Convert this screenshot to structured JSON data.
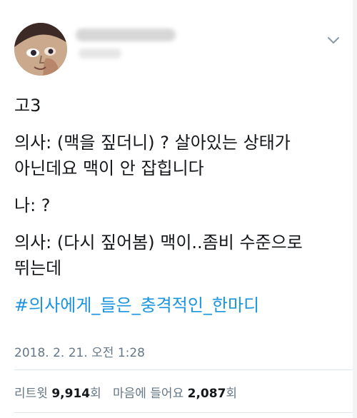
{
  "tweet": {
    "text_lines": {
      "line1": "고3",
      "line2a": "의사: (맥을 짚더니) ? 살아있는 상태가",
      "line2b": "아닌데요 맥이 안 잡힙니다",
      "line3": "나: ?",
      "line4a": "의사: (다시 짚어봄) 맥이..좀비 수준으로",
      "line4b": "뛰는데",
      "hashtag": "#의사에게_들은_충격적인_한마디"
    },
    "timestamp": "2018. 2. 21. 오전 1:28",
    "stats": {
      "retweet_label": "리트윗",
      "retweet_count": "9,914",
      "retweet_unit": "회",
      "like_label": "마음에 들어요",
      "like_count": "2,087",
      "like_unit": "회"
    },
    "icons": {
      "menu": "chevron-down-icon",
      "avatar": "avatar-image"
    },
    "colors": {
      "hashtag": "#1b95e0",
      "meta": "#657786",
      "text": "#14171a"
    }
  }
}
